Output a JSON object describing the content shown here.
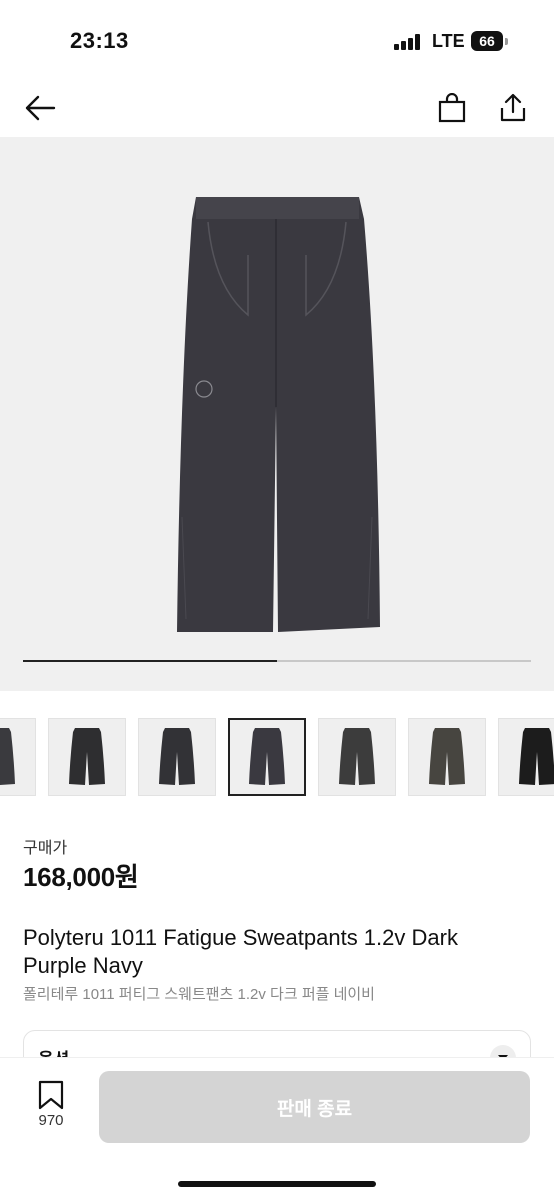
{
  "status_bar": {
    "time": "23:13",
    "network": "LTE",
    "battery": "66"
  },
  "nav": {
    "back_icon": "arrow-left-icon",
    "bag_icon": "shopping-bag-icon",
    "share_icon": "share-icon"
  },
  "gallery": {
    "progress": 0.5,
    "product_color": "#3a3940"
  },
  "thumbnails": {
    "active_index": 3,
    "items": [
      {
        "color": "#3a3a3e"
      },
      {
        "color": "#2e2e30"
      },
      {
        "color": "#323236"
      },
      {
        "color": "#3a3940"
      },
      {
        "color": "#3c3c3c"
      },
      {
        "color": "#474540"
      },
      {
        "color": "#1c1c1c"
      }
    ]
  },
  "price": {
    "label": "구매가",
    "value": "168,000원"
  },
  "product": {
    "title_en": "Polyteru 1011 Fatigue Sweatpants 1.2v Dark Purple Navy",
    "title_ko": "폴리테루 1011 퍼티그 스웨트팬츠 1.2v 다크 퍼플 네이비"
  },
  "option": {
    "label": "옵션"
  },
  "bottom_bar": {
    "bookmark_count": "970",
    "cta_label": "판매 종료"
  },
  "colors": {
    "cta_disabled": "#d4d4d4",
    "gallery_bg": "#f0f0f0"
  }
}
